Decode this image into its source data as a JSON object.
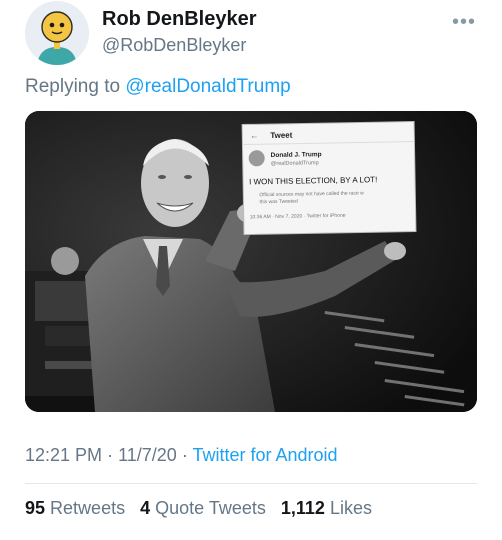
{
  "tweet": {
    "author_name": "Rob DenBleyker",
    "author_handle": "@RobDenBleyker",
    "replying_prefix": "Replying to",
    "replying_to": "@realDonaldTrump",
    "time": "12:21 PM",
    "date": "11/7/20",
    "source": "Twitter for Android",
    "more_icon": "more-icon"
  },
  "media": {
    "card_header": "Tweet",
    "card_author": "Donald J. Trump",
    "card_handle": "@realDonaldTrump",
    "card_text": "I WON THIS ELECTION, BY A LOT!",
    "card_notice_1": "Official sources may not have called the race w",
    "card_notice_2": "this was Tweeted",
    "card_footer": "10:36 AM · Nov 7, 2020 · Twitter for iPhone"
  },
  "stats": {
    "retweets_count": "95",
    "retweets_label": "Retweets",
    "quotes_count": "4",
    "quotes_label": "Quote Tweets",
    "likes_count": "1,112",
    "likes_label": "Likes"
  },
  "colors": {
    "accent": "#1da1f2",
    "muted": "#657786",
    "text": "#14171a"
  }
}
